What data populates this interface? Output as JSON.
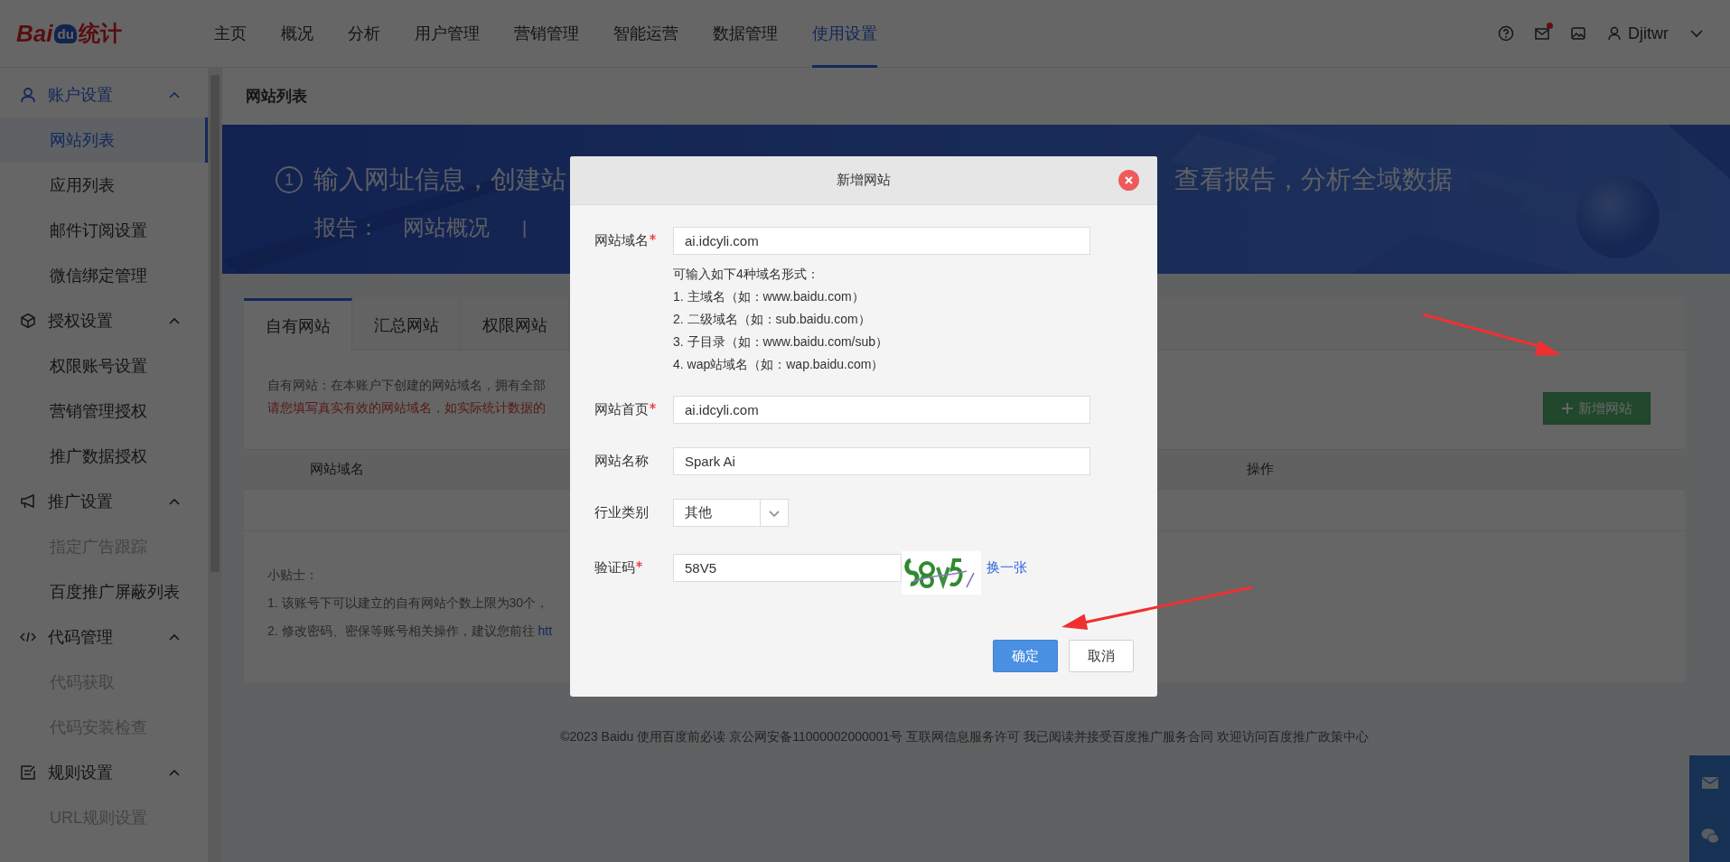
{
  "header": {
    "logo": {
      "part1": "Bai",
      "part2": "du",
      "part3": "统计"
    },
    "nav": [
      {
        "label": "主页",
        "selected": false
      },
      {
        "label": "概况",
        "selected": false
      },
      {
        "label": "分析",
        "selected": false
      },
      {
        "label": "用户管理",
        "selected": false
      },
      {
        "label": "营销管理",
        "selected": false
      },
      {
        "label": "智能运营",
        "selected": false
      },
      {
        "label": "数据管理",
        "selected": false
      },
      {
        "label": "使用设置",
        "selected": true
      }
    ],
    "mail_unread": true,
    "user": "Djitwr"
  },
  "sidebar": {
    "groups": [
      {
        "label": "账户设置",
        "expanded": true,
        "selected": true,
        "items": [
          {
            "label": "网站列表",
            "selected": true,
            "disabled": false
          },
          {
            "label": "应用列表",
            "selected": false,
            "disabled": false
          },
          {
            "label": "邮件订阅设置",
            "selected": false,
            "disabled": false
          },
          {
            "label": "微信绑定管理",
            "selected": false,
            "disabled": false
          }
        ]
      },
      {
        "label": "授权设置",
        "expanded": true,
        "selected": false,
        "items": [
          {
            "label": "权限账号设置",
            "selected": false,
            "disabled": false
          },
          {
            "label": "营销管理授权",
            "selected": false,
            "disabled": false
          },
          {
            "label": "推广数据授权",
            "selected": false,
            "disabled": false
          }
        ]
      },
      {
        "label": "推广设置",
        "expanded": true,
        "selected": false,
        "items": [
          {
            "label": "指定广告跟踪",
            "selected": false,
            "disabled": true
          },
          {
            "label": "百度推广屏蔽列表",
            "selected": false,
            "disabled": false
          }
        ]
      },
      {
        "label": "代码管理",
        "expanded": true,
        "selected": false,
        "items": [
          {
            "label": "代码获取",
            "selected": false,
            "disabled": true
          },
          {
            "label": "代码安装检查",
            "selected": false,
            "disabled": true
          }
        ]
      },
      {
        "label": "规则设置",
        "expanded": true,
        "selected": false,
        "items": [
          {
            "label": "URL规则设置",
            "selected": false,
            "disabled": true
          }
        ]
      }
    ]
  },
  "page_title": "网站列表",
  "banner": {
    "step_number": "1",
    "step_text": "输入网址信息，创建站",
    "report_label": "报告：",
    "report_link": "网站概况",
    "separator": "|",
    "right_text": "查看报告，分析全域数据"
  },
  "tabs": [
    {
      "label": "自有网站",
      "selected": true
    },
    {
      "label": "汇总网站",
      "selected": false
    },
    {
      "label": "权限网站",
      "selected": false
    }
  ],
  "description": "自有网站：在本账户下创建的网站域名，拥有全部",
  "warning": "请您填写真实有效的网站域名，如实际统计数据的",
  "add_button": "新增网站",
  "table": {
    "columns": [
      "网站域名",
      "操作"
    ]
  },
  "tips": {
    "title": "小贴士：",
    "line1": "1. 该账号下可以建立的自有网站个数上限为30个，",
    "line2": "2. 修改密码、密保等账号相关操作，建议您前往 ",
    "line2_link": "htt"
  },
  "footer": "©2023 Baidu 使用百度前必读 京公网安备11000002000001号 互联网信息服务许可 我已阅读并接受百度推广服务合同 欢迎访问百度推广政策中心",
  "modal": {
    "title": "新增网站",
    "fields": [
      {
        "kind": "text",
        "label": "网站域名",
        "required": true,
        "value": "ai.idcyli.com",
        "hints": [
          "可输入如下4种域名形式：",
          "1. 主域名（如：www.baidu.com）",
          "2. 二级域名（如：sub.baidu.com）",
          "3. 子目录（如：www.baidu.com/sub）",
          "4. wap站域名（如：wap.baidu.com）"
        ]
      },
      {
        "kind": "text",
        "label": "网站首页",
        "required": true,
        "value": "ai.idcyli.com"
      },
      {
        "kind": "text",
        "label": "网站名称",
        "required": false,
        "value": "Spark Ai"
      },
      {
        "kind": "select",
        "label": "行业类别",
        "required": false,
        "value": "其他"
      },
      {
        "kind": "captcha",
        "label": "验证码",
        "required": true,
        "value": "58V5",
        "refresh_link": "换一张"
      }
    ],
    "buttons": [
      {
        "label": "确定",
        "kind": "primary"
      },
      {
        "label": "取消",
        "kind": "default"
      }
    ]
  }
}
